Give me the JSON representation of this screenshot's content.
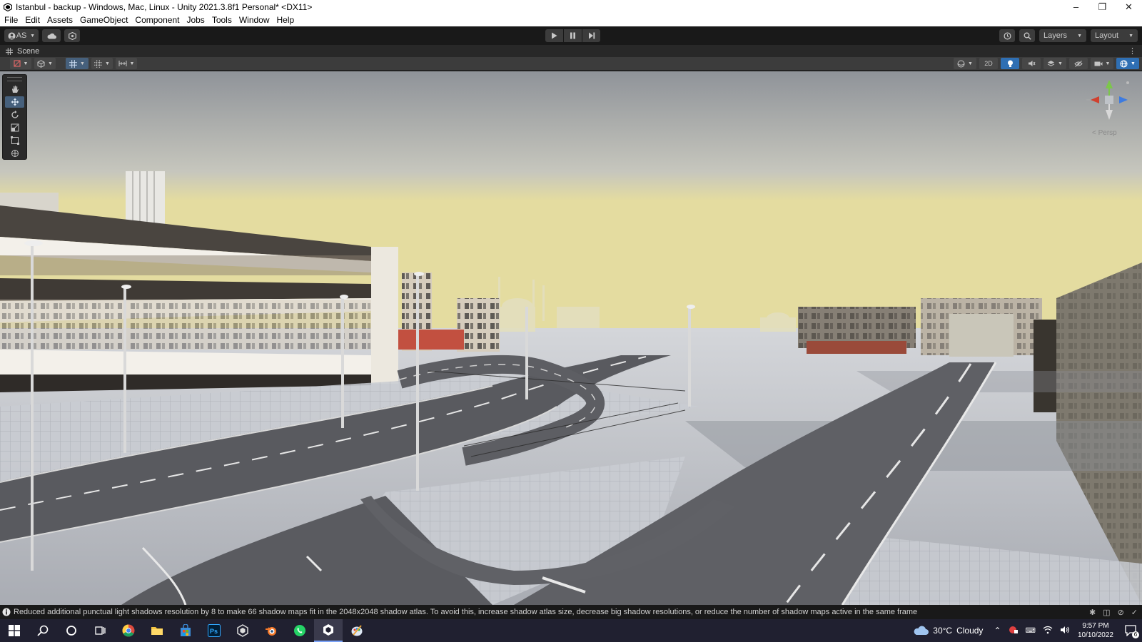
{
  "window": {
    "title": "Istanbul - backup - Windows, Mac, Linux - Unity 2021.3.8f1 Personal* <DX11>",
    "controls": [
      "minimize",
      "restore",
      "close"
    ]
  },
  "menu": {
    "items": [
      "File",
      "Edit",
      "Assets",
      "GameObject",
      "Component",
      "Jobs",
      "Tools",
      "Window",
      "Help"
    ]
  },
  "toolbar": {
    "account_label": "AS",
    "layers_label": "Layers",
    "layout_label": "Layout"
  },
  "scene_tab": {
    "label": "Scene"
  },
  "scene_toolbar": {
    "mode_2d_label": "2D"
  },
  "viewport": {
    "projection_label": "< Persp",
    "sky_top": "#8f9399",
    "sky_horizon": "#e4dca0",
    "ground": "#b9bcc3",
    "road": "#5a5b60"
  },
  "status": {
    "message": "Reduced additional punctual light shadows resolution by 8 to make 66 shadow maps fit in the 2048x2048 shadow atlas. To avoid this, increase shadow atlas size, decrease big shadow resolutions, or reduce the number of shadow maps active in the same frame"
  },
  "taskbar": {
    "weather_temp": "30°C",
    "weather_desc": "Cloudy",
    "time": "9:57 PM",
    "date": "10/10/2022",
    "notification_count": "6"
  }
}
